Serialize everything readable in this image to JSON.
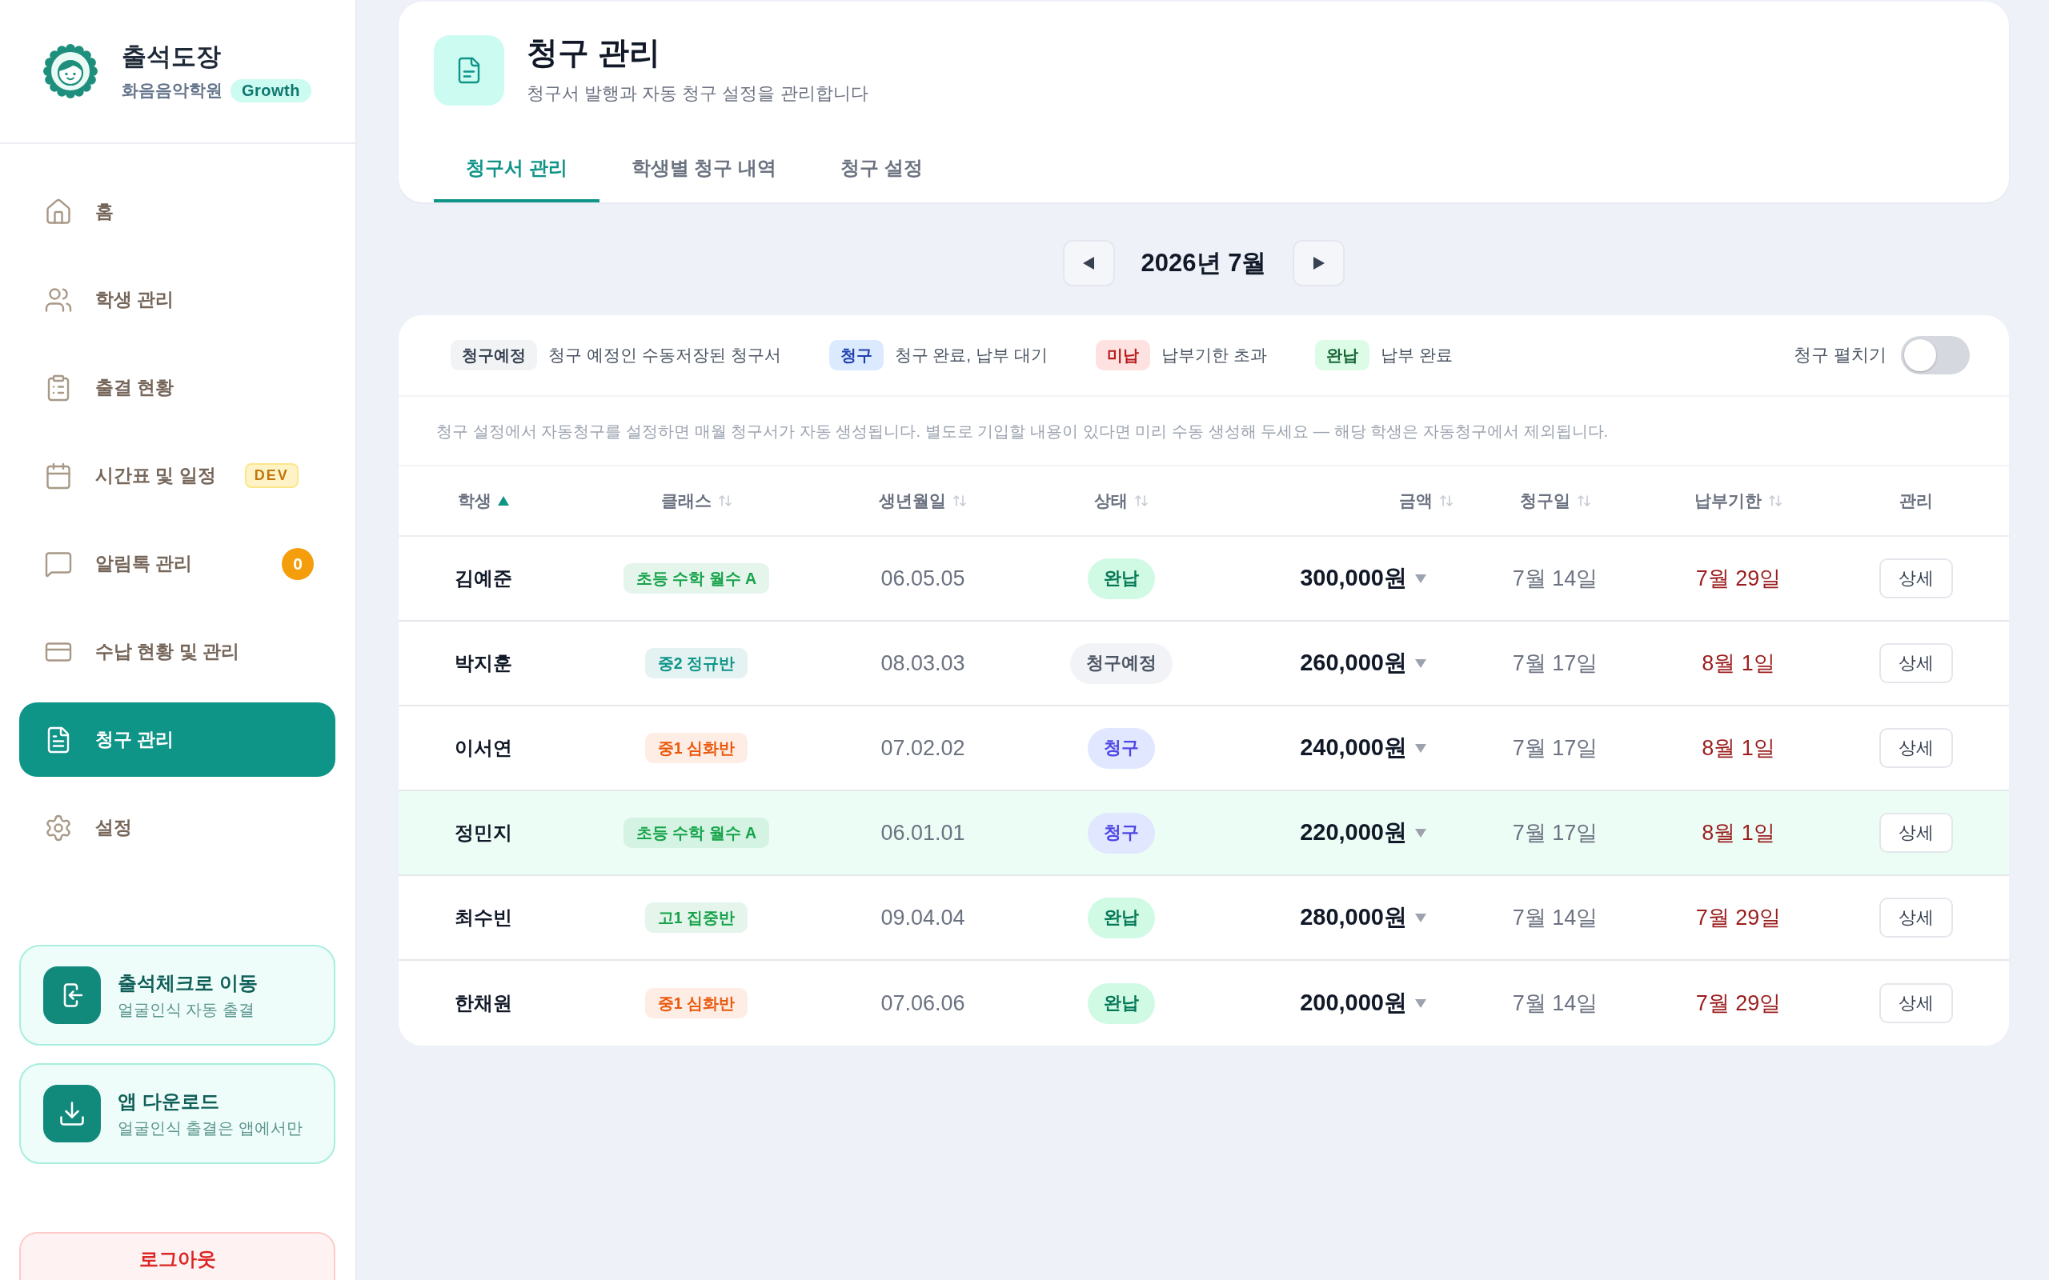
{
  "sidebar": {
    "brand": {
      "title": "출석도장",
      "academy": "화음음악학원",
      "plan": "Growth"
    },
    "nav": [
      {
        "label": "홈",
        "selected": false
      },
      {
        "label": "학생 관리",
        "selected": false
      },
      {
        "label": "출결 현황",
        "selected": false
      },
      {
        "label": "시간표 및 일정",
        "selected": false,
        "tag": "DEV"
      },
      {
        "label": "알림톡 관리",
        "selected": false,
        "count": "0"
      },
      {
        "label": "수납 현황 및 관리",
        "selected": false
      },
      {
        "label": "청구 관리",
        "selected": true
      },
      {
        "label": "설정",
        "selected": false
      }
    ],
    "shortcuts": [
      {
        "title": "출석체크로 이동",
        "subtitle": "얼굴인식 자동 출결"
      },
      {
        "title": "앱 다운로드",
        "subtitle": "얼굴인식 출결은 앱에서만"
      }
    ],
    "logout": "로그아웃"
  },
  "header": {
    "title": "청구 관리",
    "subtitle": "청구서 발행과 자동 청구 설정을 관리합니다",
    "tabs": [
      {
        "label": "청구서 관리",
        "selected": true
      },
      {
        "label": "학생별 청구 내역",
        "selected": false
      },
      {
        "label": "청구 설정",
        "selected": false
      }
    ]
  },
  "month_nav": {
    "label": "2026년 7월"
  },
  "legend": {
    "items": [
      {
        "kind": "scheduled",
        "badge": "청구예정",
        "text": "청구 예정인 수동저장된 청구서"
      },
      {
        "kind": "billed",
        "badge": "청구",
        "text": "청구 완료, 납부 대기"
      },
      {
        "kind": "unpaid",
        "badge": "미납",
        "text": "납부기한 초과"
      },
      {
        "kind": "paid",
        "badge": "완납",
        "text": "납부 완료"
      }
    ],
    "toggle": {
      "label": "청구 펼치기",
      "on": false
    }
  },
  "note": "청구 설정에서 자동청구를 설정하면 매월 청구서가 자동 생성됩니다. 별도로 기입할 내용이 있다면 미리 수동 생성해 두세요 — 해당 학생은 자동청구에서 제외됩니다.",
  "table": {
    "columns": [
      {
        "label": "학생",
        "sortable": true,
        "sorted": true
      },
      {
        "label": "클래스",
        "sortable": true,
        "sorted": false
      },
      {
        "label": "생년월일",
        "sortable": true,
        "sorted": false
      },
      {
        "label": "상태",
        "sortable": true,
        "sorted": false
      },
      {
        "label": "금액",
        "sortable": true,
        "sorted": false
      },
      {
        "label": "청구일",
        "sortable": true,
        "sorted": false
      },
      {
        "label": "납부기한",
        "sortable": true,
        "sorted": false
      },
      {
        "label": "관리",
        "sortable": false
      }
    ],
    "rows": [
      {
        "selected": false,
        "student": "김예준",
        "class": {
          "label": "초등 수학 월수 A",
          "color": "#16a34a"
        },
        "birthdate": "06.05.05",
        "status": {
          "label": "완납",
          "kind": "paid"
        },
        "amount": "300,000원",
        "billed": "7월 14일",
        "due": "7월 29일",
        "action": "상세"
      },
      {
        "selected": false,
        "student": "박지훈",
        "class": {
          "label": "중2 정규반",
          "color": "#0d9488"
        },
        "birthdate": "08.03.03",
        "status": {
          "label": "청구예정",
          "kind": "scheduled"
        },
        "amount": "260,000원",
        "billed": "7월 17일",
        "due": "8월 1일",
        "action": "상세"
      },
      {
        "selected": false,
        "student": "이서연",
        "class": {
          "label": "중1 심화반",
          "color": "#ea580c"
        },
        "birthdate": "07.02.02",
        "status": {
          "label": "청구",
          "kind": "billed"
        },
        "amount": "240,000원",
        "billed": "7월 17일",
        "due": "8월 1일",
        "action": "상세"
      },
      {
        "selected": true,
        "student": "정민지",
        "class": {
          "label": "초등 수학 월수 A",
          "color": "#16a34a"
        },
        "birthdate": "06.01.01",
        "status": {
          "label": "청구",
          "kind": "billed"
        },
        "amount": "220,000원",
        "billed": "7월 17일",
        "due": "8월 1일",
        "action": "상세"
      },
      {
        "selected": false,
        "student": "최수빈",
        "class": {
          "label": "고1 집중반",
          "color": "#16a34a"
        },
        "birthdate": "09.04.04",
        "status": {
          "label": "완납",
          "kind": "paid"
        },
        "amount": "280,000원",
        "billed": "7월 14일",
        "due": "7월 29일",
        "action": "상세"
      },
      {
        "selected": false,
        "student": "한채원",
        "class": {
          "label": "중1 심화반",
          "color": "#ea580c"
        },
        "birthdate": "07.06.06",
        "status": {
          "label": "완납",
          "kind": "paid"
        },
        "amount": "200,000원",
        "billed": "7월 14일",
        "due": "7월 29일",
        "action": "상세"
      }
    ]
  }
}
